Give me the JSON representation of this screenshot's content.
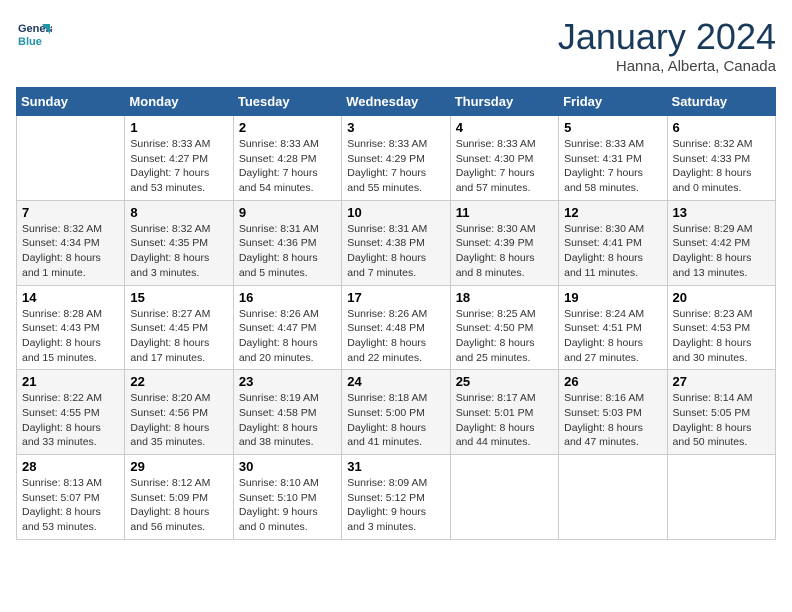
{
  "header": {
    "logo_line1": "General",
    "logo_line2": "Blue",
    "month": "January 2024",
    "location": "Hanna, Alberta, Canada"
  },
  "weekdays": [
    "Sunday",
    "Monday",
    "Tuesday",
    "Wednesday",
    "Thursday",
    "Friday",
    "Saturday"
  ],
  "weeks": [
    [
      {
        "day": "",
        "info": ""
      },
      {
        "day": "1",
        "info": "Sunrise: 8:33 AM\nSunset: 4:27 PM\nDaylight: 7 hours\nand 53 minutes."
      },
      {
        "day": "2",
        "info": "Sunrise: 8:33 AM\nSunset: 4:28 PM\nDaylight: 7 hours\nand 54 minutes."
      },
      {
        "day": "3",
        "info": "Sunrise: 8:33 AM\nSunset: 4:29 PM\nDaylight: 7 hours\nand 55 minutes."
      },
      {
        "day": "4",
        "info": "Sunrise: 8:33 AM\nSunset: 4:30 PM\nDaylight: 7 hours\nand 57 minutes."
      },
      {
        "day": "5",
        "info": "Sunrise: 8:33 AM\nSunset: 4:31 PM\nDaylight: 7 hours\nand 58 minutes."
      },
      {
        "day": "6",
        "info": "Sunrise: 8:32 AM\nSunset: 4:33 PM\nDaylight: 8 hours\nand 0 minutes."
      }
    ],
    [
      {
        "day": "7",
        "info": "Sunrise: 8:32 AM\nSunset: 4:34 PM\nDaylight: 8 hours\nand 1 minute."
      },
      {
        "day": "8",
        "info": "Sunrise: 8:32 AM\nSunset: 4:35 PM\nDaylight: 8 hours\nand 3 minutes."
      },
      {
        "day": "9",
        "info": "Sunrise: 8:31 AM\nSunset: 4:36 PM\nDaylight: 8 hours\nand 5 minutes."
      },
      {
        "day": "10",
        "info": "Sunrise: 8:31 AM\nSunset: 4:38 PM\nDaylight: 8 hours\nand 7 minutes."
      },
      {
        "day": "11",
        "info": "Sunrise: 8:30 AM\nSunset: 4:39 PM\nDaylight: 8 hours\nand 8 minutes."
      },
      {
        "day": "12",
        "info": "Sunrise: 8:30 AM\nSunset: 4:41 PM\nDaylight: 8 hours\nand 11 minutes."
      },
      {
        "day": "13",
        "info": "Sunrise: 8:29 AM\nSunset: 4:42 PM\nDaylight: 8 hours\nand 13 minutes."
      }
    ],
    [
      {
        "day": "14",
        "info": "Sunrise: 8:28 AM\nSunset: 4:43 PM\nDaylight: 8 hours\nand 15 minutes."
      },
      {
        "day": "15",
        "info": "Sunrise: 8:27 AM\nSunset: 4:45 PM\nDaylight: 8 hours\nand 17 minutes."
      },
      {
        "day": "16",
        "info": "Sunrise: 8:26 AM\nSunset: 4:47 PM\nDaylight: 8 hours\nand 20 minutes."
      },
      {
        "day": "17",
        "info": "Sunrise: 8:26 AM\nSunset: 4:48 PM\nDaylight: 8 hours\nand 22 minutes."
      },
      {
        "day": "18",
        "info": "Sunrise: 8:25 AM\nSunset: 4:50 PM\nDaylight: 8 hours\nand 25 minutes."
      },
      {
        "day": "19",
        "info": "Sunrise: 8:24 AM\nSunset: 4:51 PM\nDaylight: 8 hours\nand 27 minutes."
      },
      {
        "day": "20",
        "info": "Sunrise: 8:23 AM\nSunset: 4:53 PM\nDaylight: 8 hours\nand 30 minutes."
      }
    ],
    [
      {
        "day": "21",
        "info": "Sunrise: 8:22 AM\nSunset: 4:55 PM\nDaylight: 8 hours\nand 33 minutes."
      },
      {
        "day": "22",
        "info": "Sunrise: 8:20 AM\nSunset: 4:56 PM\nDaylight: 8 hours\nand 35 minutes."
      },
      {
        "day": "23",
        "info": "Sunrise: 8:19 AM\nSunset: 4:58 PM\nDaylight: 8 hours\nand 38 minutes."
      },
      {
        "day": "24",
        "info": "Sunrise: 8:18 AM\nSunset: 5:00 PM\nDaylight: 8 hours\nand 41 minutes."
      },
      {
        "day": "25",
        "info": "Sunrise: 8:17 AM\nSunset: 5:01 PM\nDaylight: 8 hours\nand 44 minutes."
      },
      {
        "day": "26",
        "info": "Sunrise: 8:16 AM\nSunset: 5:03 PM\nDaylight: 8 hours\nand 47 minutes."
      },
      {
        "day": "27",
        "info": "Sunrise: 8:14 AM\nSunset: 5:05 PM\nDaylight: 8 hours\nand 50 minutes."
      }
    ],
    [
      {
        "day": "28",
        "info": "Sunrise: 8:13 AM\nSunset: 5:07 PM\nDaylight: 8 hours\nand 53 minutes."
      },
      {
        "day": "29",
        "info": "Sunrise: 8:12 AM\nSunset: 5:09 PM\nDaylight: 8 hours\nand 56 minutes."
      },
      {
        "day": "30",
        "info": "Sunrise: 8:10 AM\nSunset: 5:10 PM\nDaylight: 9 hours\nand 0 minutes."
      },
      {
        "day": "31",
        "info": "Sunrise: 8:09 AM\nSunset: 5:12 PM\nDaylight: 9 hours\nand 3 minutes."
      },
      {
        "day": "",
        "info": ""
      },
      {
        "day": "",
        "info": ""
      },
      {
        "day": "",
        "info": ""
      }
    ]
  ]
}
